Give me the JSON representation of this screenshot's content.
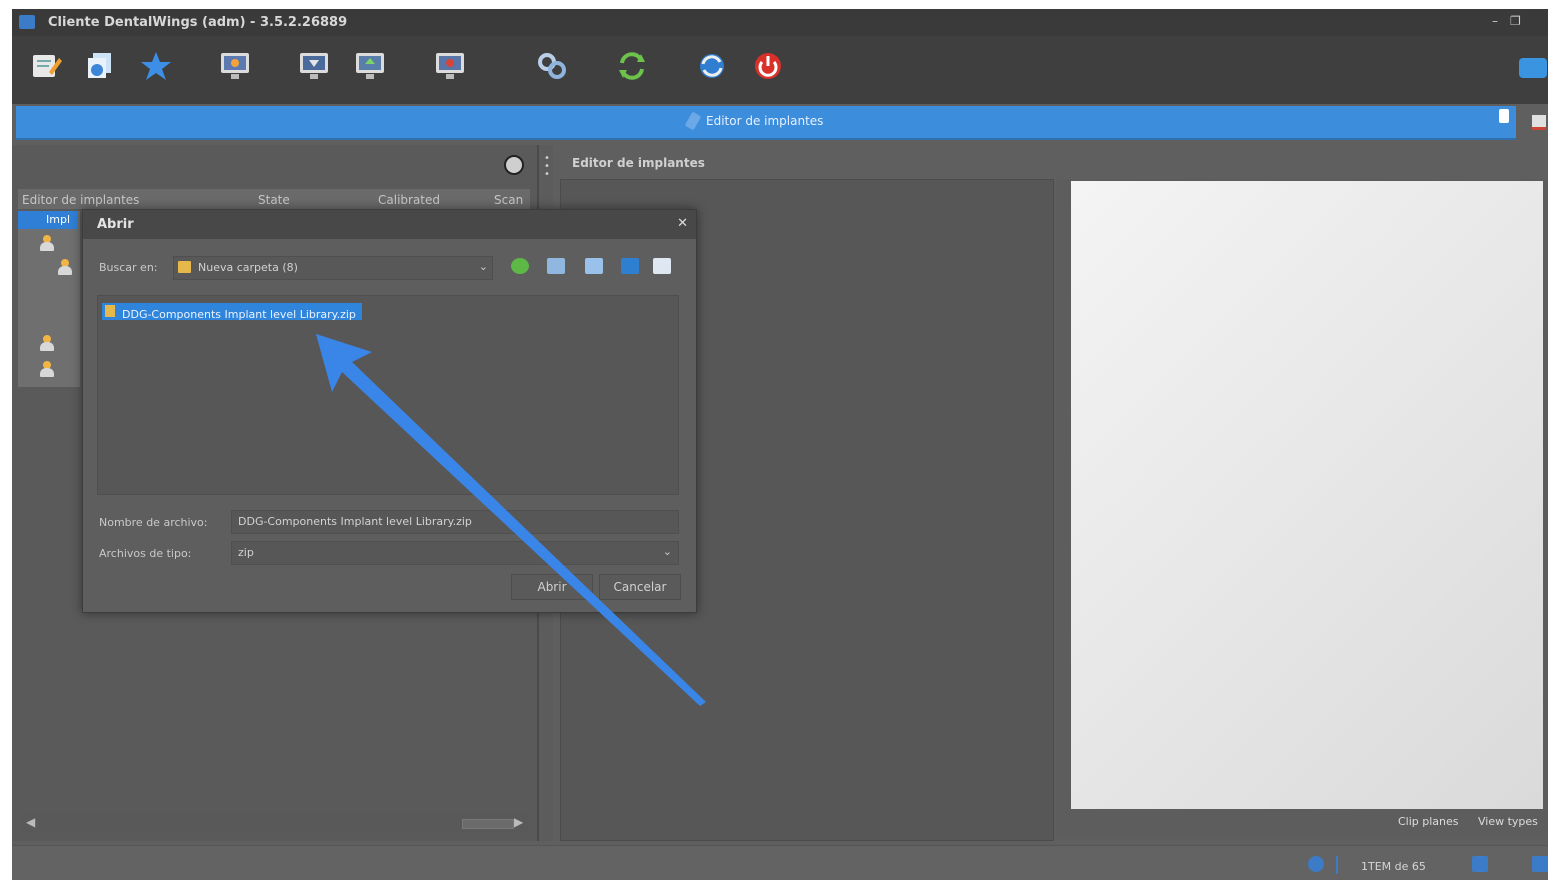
{
  "window": {
    "title": "Cliente DentalWings (adm) - 3.5.2.26889",
    "minimize": "–",
    "restore": "❐"
  },
  "toolbar": {
    "icons": [
      "edit-icon",
      "documents-icon",
      "star-icon",
      "monitor-icon",
      "monitor-scan-icon",
      "monitor-upload-icon",
      "monitor-red-icon",
      "link-icon",
      "sync-icon",
      "refresh-globe-icon",
      "power-icon"
    ]
  },
  "header": {
    "label": "Editor de implantes"
  },
  "left_panel": {
    "columns": [
      "Editor de implantes",
      "State",
      "Calibrated",
      "Scan"
    ],
    "tree_selected": "Impl"
  },
  "editor": {
    "title": "Editor de implantes",
    "links": [
      "Clip planes",
      "View types"
    ]
  },
  "dialog": {
    "title": "Abrir",
    "lookin_label": "Buscar en:",
    "lookin_value": "Nueva carpeta (8)",
    "selected_file": "DDG-Components Implant level Library.zip",
    "filename_label": "Nombre de archivo:",
    "filename_value": "DDG-Components Implant level Library.zip",
    "filetype_label": "Archivos de tipo:",
    "filetype_value": "zip",
    "open_label": "Abrir",
    "cancel_label": "Cancelar"
  },
  "status": {
    "text": "1TEM de 65"
  },
  "colors": {
    "accent": "#3c8ddc",
    "selection": "#2f84db",
    "arrow": "#3a86e8"
  }
}
